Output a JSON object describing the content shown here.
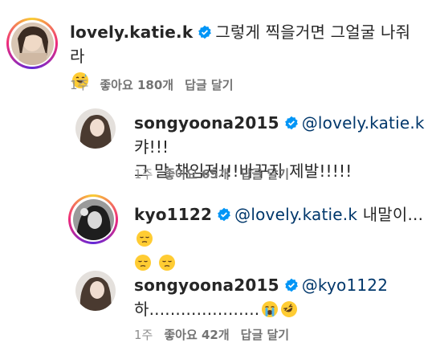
{
  "comments": [
    {
      "username": "lovely.katie.k",
      "mention": "",
      "text": "그렇게 찍을거면 그얼굴 나줘라",
      "time": "1주",
      "likes_label": "좋아요 180개",
      "reply_label": "답글 달기",
      "emoji": [
        "grinning-sweat-face"
      ]
    },
    {
      "username": "songyoona2015",
      "mention": "@lovely.katie.k",
      "text_line1": "캬!!!",
      "text_line2": "그 말 책임져!!!바꾸자 제발!!!!!",
      "time": "1주",
      "likes_label": "좋아요 65개",
      "reply_label": "답글 달기"
    },
    {
      "username": "kyo1122",
      "mention": "@lovely.katie.k",
      "text": "내말이...",
      "emoji": [
        "pensive-face",
        "pensive-face",
        "pensive-face"
      ]
    },
    {
      "username": "songyoona2015",
      "mention": "@kyo1122",
      "text": "하.....................",
      "time": "1주",
      "likes_label": "좋아요 42개",
      "reply_label": "답글 달기",
      "emoji": [
        "loudly-crying-face",
        "rolling-laughing-face"
      ]
    }
  ],
  "colors": {
    "verified": "#0095f6",
    "mention": "#00376b",
    "meta": "#8e8e8e"
  }
}
